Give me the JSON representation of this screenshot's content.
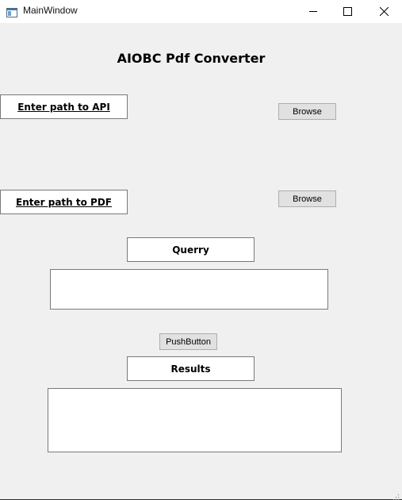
{
  "window": {
    "title": "MainWindow",
    "icon": "app-window-icon",
    "controls": {
      "minimize_icon": "minimize-icon",
      "maximize_icon": "maximize-icon",
      "close_icon": "close-icon"
    }
  },
  "main": {
    "heading": "AIOBC Pdf Converter",
    "api_label": "Enter path to API",
    "api_browse_label": "Browse",
    "pdf_label": "Enter path to PDF",
    "pdf_browse_label": "Browse",
    "query_label": "Querry",
    "query_value": "",
    "push_button_label": "PushButton",
    "results_label": "Results",
    "results_value": ""
  },
  "colors": {
    "window_background": "#f0f0f0",
    "titlebar_background": "#ffffff",
    "button_face": "#e1e1e1",
    "button_border": "#adadad",
    "field_border": "#7a7a7a"
  }
}
